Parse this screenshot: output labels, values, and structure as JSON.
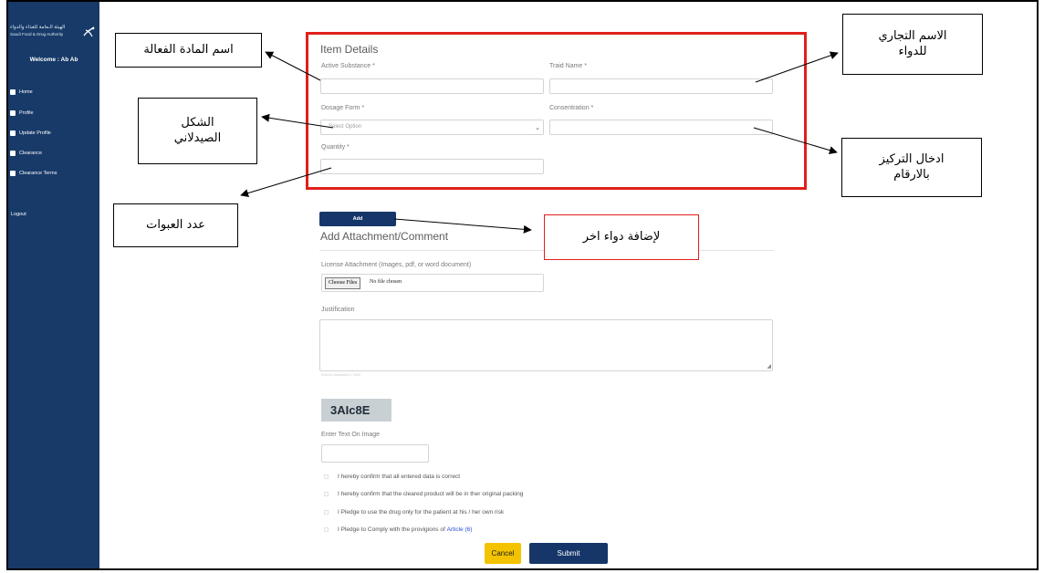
{
  "sidebar": {
    "brand_ar": "الهيئة الـعامة للغذاء والدواء",
    "brand_en": "Saudi Food & Drug Authority",
    "welcome": "Welcome : Ab Ab",
    "items": [
      {
        "label": "Home",
        "icon": "home-icon"
      },
      {
        "label": "Profile",
        "icon": "profile-icon"
      },
      {
        "label": "Update Profile",
        "icon": "edit-icon"
      },
      {
        "label": "Clearance",
        "icon": "document-icon"
      },
      {
        "label": "Clearance Terms",
        "icon": "document-icon"
      }
    ],
    "logout": "Logout",
    "bg_color": "#173a68"
  },
  "item_details": {
    "title": "Item Details",
    "active_substance_label": "Active Substance *",
    "trade_name_label": "Traid Name *",
    "dosage_form_label": "Dosage Form *",
    "dosage_form_value": "Select Option",
    "concentration_label": "Consentration *",
    "quantity_label": "Quantity *"
  },
  "add_button": "Add",
  "attachment": {
    "title": "Add Attachment/Comment",
    "license_label": "License Attachment (Images, pdf, or word document)",
    "choose_files": "Choose Files",
    "no_file": "No file chosen",
    "justification_label": "Justification",
    "hint": "Entered characters 0 / 4000"
  },
  "captcha": {
    "code": "3AIc8E",
    "label": "Enter Text On Image"
  },
  "confirmations": [
    "I hereby confirm that all entered data is correct",
    "I hereby confirm that the cleared product will be in ther original packing",
    "I Pledge to use the drug only for the patient at his / her own risk",
    "I Pledge to Comply with the provigions of"
  ],
  "article_link": "Article (6)",
  "buttons": {
    "cancel": "Cancel",
    "submit": "Submit"
  },
  "annotations": {
    "active_substance": "اسم المادة الفعالة",
    "trade_name": "الاسم التجاري للدواء",
    "dosage_form": "الشكل الصيدلاني",
    "concentration": "ادخال التركيز بالارقام",
    "quantity": "عدد العبوات",
    "add_drug": "لإضافة دواء اخر"
  },
  "colors": {
    "primary": "#16366a",
    "cancel": "#f3c300",
    "highlight": "#e0201b",
    "link": "#2c4fd9"
  }
}
